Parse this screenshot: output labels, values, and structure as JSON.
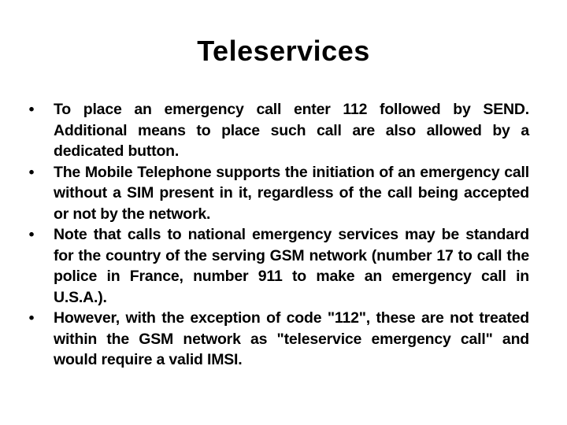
{
  "slide": {
    "title": "Teleservices",
    "bullet_glyph": "•",
    "bullets": [
      "To place an emergency call enter 112 followed by SEND. Additional means to place such call are also allowed by a dedicated button.",
      "The Mobile Telephone supports the initiation of an emergency call without a SIM present in it, regardless of the call being accepted or not by the network.",
      "Note that calls to national emergency services may be standard for the country of the serving GSM network (number 17 to call the police in France, number 911 to make an emergency call in U.S.A.).",
      "However, with the exception of code \"112\", these are not treated within the GSM network as \"teleservice emergency call\" and would require a valid IMSI."
    ]
  }
}
